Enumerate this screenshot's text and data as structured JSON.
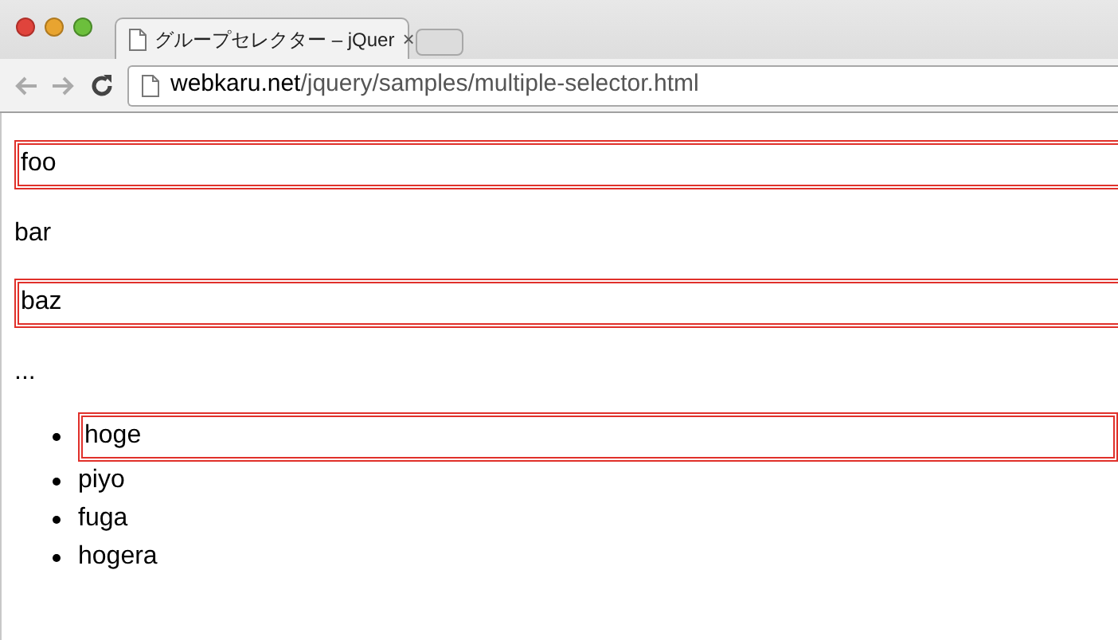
{
  "tab": {
    "title": "グループセレクター – jQuer",
    "close": "×"
  },
  "address": {
    "host": "webkaru.net",
    "path": "/jquery/samples/multiple-selector.html"
  },
  "paragraphs": [
    {
      "text": "foo",
      "highlighted": true
    },
    {
      "text": "bar",
      "highlighted": false
    },
    {
      "text": "baz",
      "highlighted": true
    },
    {
      "text": "...",
      "highlighted": false
    }
  ],
  "list_items": [
    {
      "text": "hoge",
      "highlighted": true
    },
    {
      "text": "piyo",
      "highlighted": false
    },
    {
      "text": "fuga",
      "highlighted": false
    },
    {
      "text": "hogera",
      "highlighted": false
    }
  ]
}
